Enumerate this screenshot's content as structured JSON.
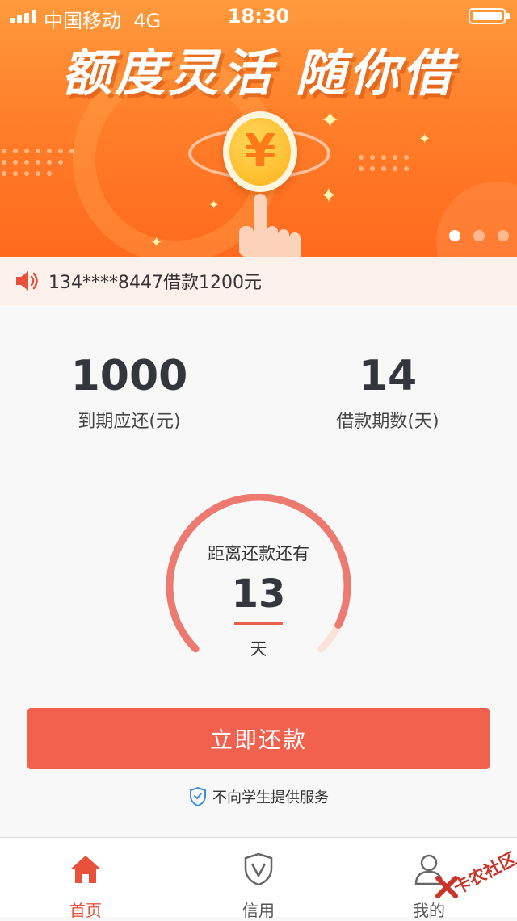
{
  "status_bar": {
    "carrier": "中国移动",
    "network": "4G",
    "time": "18:30"
  },
  "banner": {
    "slogan": "额度灵活 随你借",
    "coin_symbol": "¥",
    "slide_count": 3,
    "active_slide": 1
  },
  "notice": {
    "icon": "speaker-icon",
    "text": "134****8447借款1200元"
  },
  "stats": {
    "amount_due": {
      "value": "1000",
      "label": "到期应还(元)"
    },
    "loan_term": {
      "value": "14",
      "label": "借款期数(天)"
    }
  },
  "countdown": {
    "title": "距离还款还有",
    "days": "13",
    "unit": "天",
    "fraction_remaining": 0.93
  },
  "repay_button": {
    "label": "立即还款"
  },
  "disclaimer": {
    "icon": "shield-check-icon",
    "text": "不向学生提供服务"
  },
  "tabbar": {
    "items": [
      {
        "label": "首页",
        "icon": "home-icon",
        "active": true
      },
      {
        "label": "信用",
        "icon": "shield-v-icon",
        "active": false
      },
      {
        "label": "我的",
        "icon": "user-icon",
        "active": false
      }
    ]
  },
  "watermark": {
    "text": "卡农社区"
  },
  "colors": {
    "accent": "#f2604e",
    "banner_orange": "#ff7f2a",
    "gauge_track": "#fbe3dc",
    "gauge_arc": "#ec7a70"
  }
}
